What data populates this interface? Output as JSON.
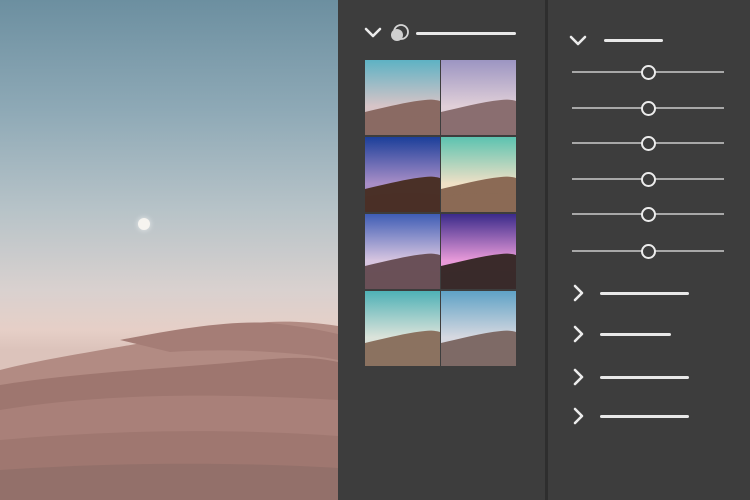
{
  "app": {
    "colors": {
      "panel_bg": "#3d3d3d",
      "divider": "#2e2e2e",
      "control_white": "#ececec",
      "slider_track": "#a8a8a8"
    }
  },
  "photo": {
    "icons": [
      "moon",
      "dunes"
    ]
  },
  "presets_panel": {
    "header_icons": [
      "chevron-down-icon",
      "color-circles-icon"
    ],
    "thumbnails": [
      {
        "sky_top": "#5eb2c4",
        "sky_bottom": "#d7c4c7",
        "sand": "#8a6a63"
      },
      {
        "sky_top": "#9c95c2",
        "sky_bottom": "#e0cfd8",
        "sand": "#8a6e70"
      },
      {
        "sky_top": "#1c3f9a",
        "sky_bottom": "#a88ec7",
        "sand": "#4a3027"
      },
      {
        "sky_top": "#5cc3b0",
        "sky_bottom": "#efe0c6",
        "sand": "#8b6a55"
      },
      {
        "sky_top": "#3f5db5",
        "sky_bottom": "#d7c5e0",
        "sand": "#6a5058"
      },
      {
        "sky_top": "#3a2b8a",
        "sky_bottom": "#e89ad9",
        "sand": "#3a2a2a"
      },
      {
        "sky_top": "#4fb1b6",
        "sky_bottom": "#dbe3da",
        "sand": "#8b7260"
      },
      {
        "sky_top": "#5fa2c6",
        "sky_bottom": "#d6d8e0",
        "sand": "#7e6a66"
      }
    ]
  },
  "adjust_panel": {
    "expanded_section_icon": "chevron-down-icon",
    "sliders": [
      {
        "value": 0.5
      },
      {
        "value": 0.5
      },
      {
        "value": 0.5
      },
      {
        "value": 0.5
      },
      {
        "value": 0.5
      },
      {
        "value": 0.5
      }
    ],
    "collapsed_section_icon": "chevron-right-icon",
    "collapsed_section_count": 4
  }
}
